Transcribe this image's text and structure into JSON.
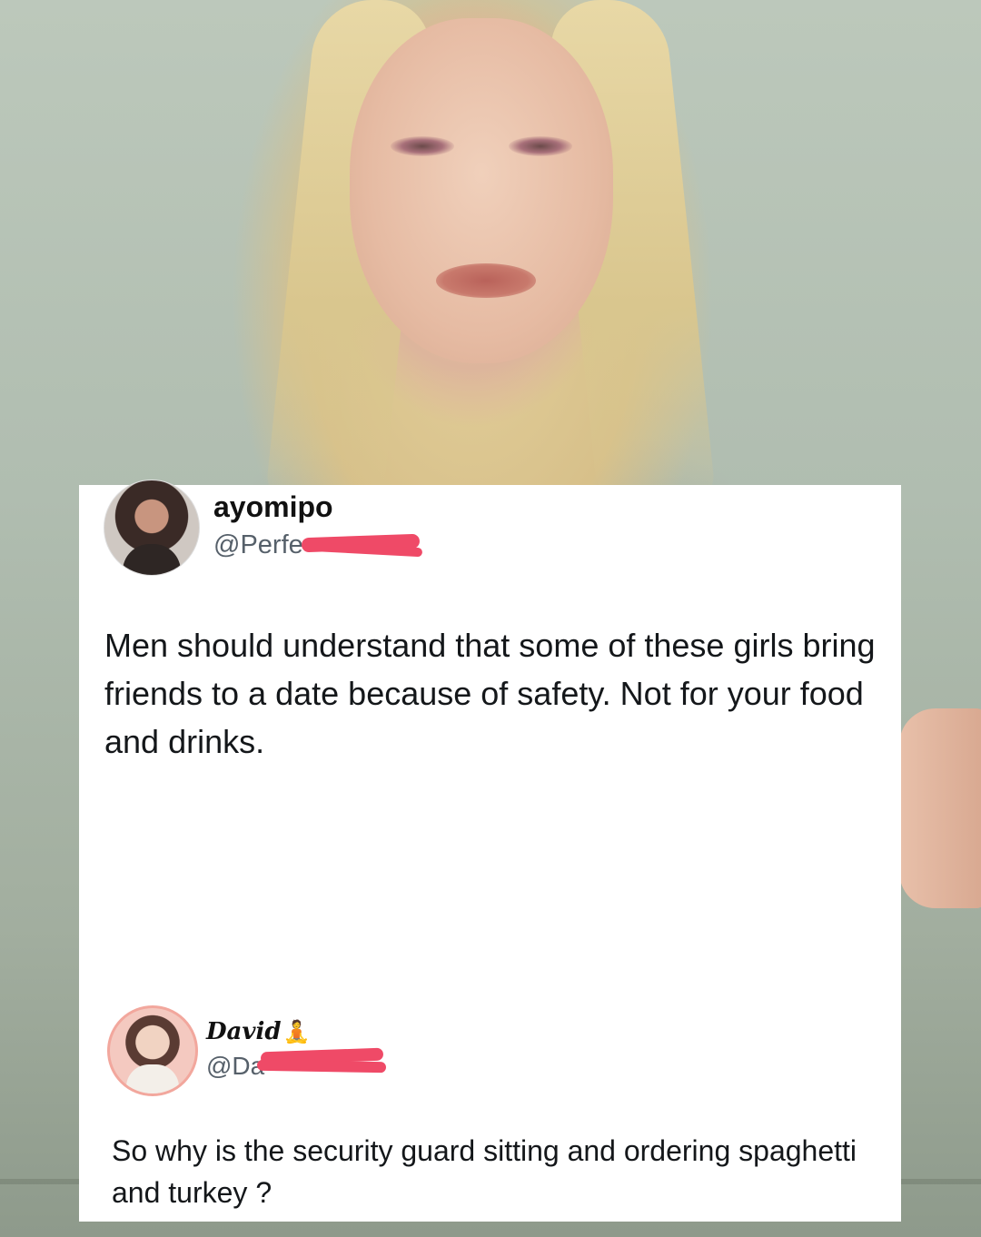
{
  "tweet1": {
    "display_name": "ayomipo",
    "handle": "@Perfe",
    "text": "Men should understand that some of these girls bring friends to a date because of safety. Not for your food and drinks."
  },
  "tweet2": {
    "display_name": "David",
    "name_emoji": "🧘",
    "handle": "@Da",
    "text": "So why is the security guard sitting and ordering spaghetti and turkey ?"
  },
  "colors": {
    "redaction": "#ef4a67",
    "avatar2_ring": "#f2a79d"
  }
}
